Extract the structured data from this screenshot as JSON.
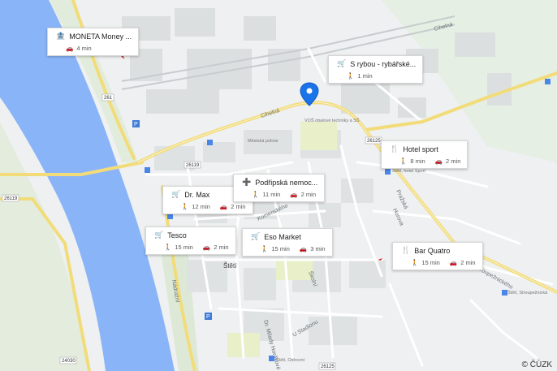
{
  "map": {
    "copyright": "© ČÚZK",
    "colors": {
      "water": "#8ab4f8",
      "road": "#ffffff",
      "main_road": "#f6e27a",
      "block": "#dfe3e4",
      "park": "#d7ecd0",
      "pin": "#1a73e8"
    },
    "street_labels": [
      {
        "text": "Cihelná"
      },
      {
        "text": "Cihelná"
      },
      {
        "text": "Pražská"
      },
      {
        "text": "Nádražní"
      },
      {
        "text": "Komenského"
      },
      {
        "text": "Školní"
      },
      {
        "text": "Horova"
      },
      {
        "text": "Stroupežnického"
      },
      {
        "text": "Dr. Milady Horákové"
      },
      {
        "text": "U Stadionu"
      },
      {
        "text": "Štětí"
      },
      {
        "text": "261"
      },
      {
        "text": "26119"
      },
      {
        "text": "26125"
      },
      {
        "text": "24030"
      },
      {
        "text": "VOŠ obalové techniky a SŠ"
      },
      {
        "text": "Městská policie"
      },
      {
        "text": "Štětí, hotel Sport"
      },
      {
        "text": "Štětí, Stroupežnická"
      },
      {
        "text": "Štětí, Ostrovní"
      }
    ]
  },
  "pois": [
    {
      "id": "moneta",
      "name": "MONETA Money ...",
      "icon": "bank-icon",
      "mode": "car",
      "time": "4 min"
    },
    {
      "id": "s-rybou",
      "name": "S rybou - rybářské...",
      "icon": "shopping-cart-icon",
      "mode": "walk",
      "time": "1 min"
    },
    {
      "id": "hotel-sport",
      "name": "Hotel sport",
      "icon": "restaurant-icon",
      "walk": "8 min",
      "car": "2 min"
    },
    {
      "id": "dr-max",
      "name": "Dr. Max",
      "icon": "shopping-cart-icon",
      "walk": "12 min",
      "car": "2 min"
    },
    {
      "id": "podripska",
      "name": "Podřipská nemoc...",
      "icon": "hospital-icon",
      "walk": "11 min",
      "car": "2 min"
    },
    {
      "id": "tesco",
      "name": "Tesco",
      "icon": "shopping-cart-icon",
      "walk": "15 min",
      "car": "2 min"
    },
    {
      "id": "eso-market",
      "name": "Eso Market",
      "icon": "shopping-cart-icon",
      "walk": "15 min",
      "car": "3 min"
    },
    {
      "id": "bar-quatro",
      "name": "Bar Quatro",
      "icon": "restaurant-icon",
      "walk": "15 min",
      "car": "2 min"
    }
  ]
}
